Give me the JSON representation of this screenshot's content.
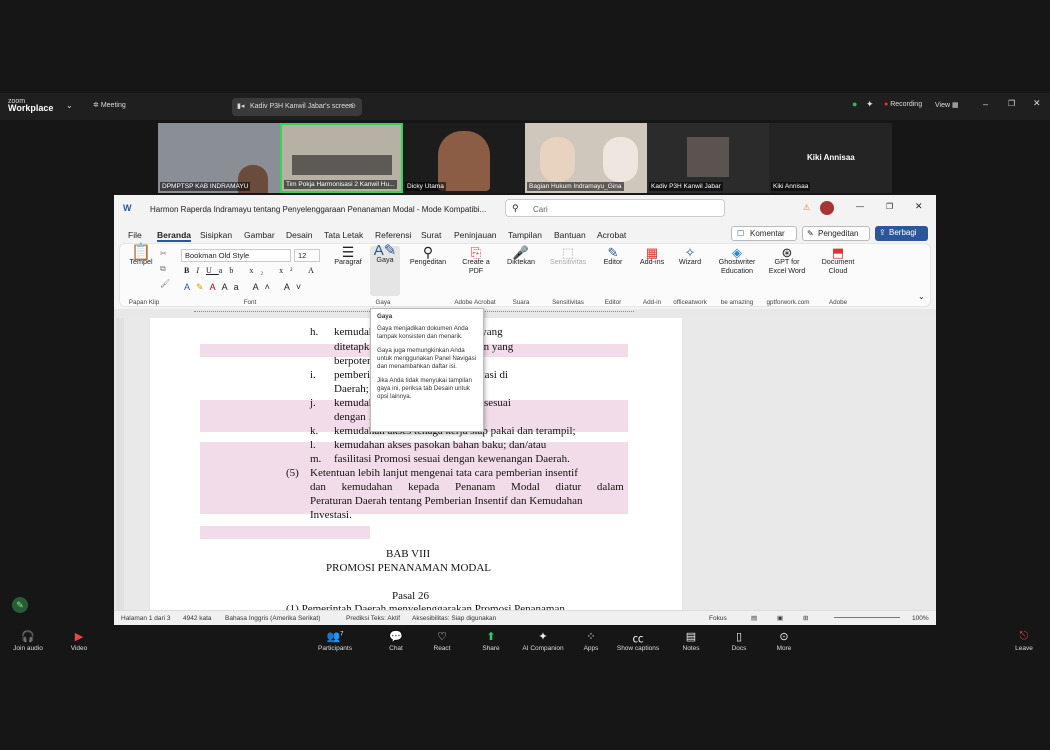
{
  "zoom_bar": {
    "logo_line1": "zoom",
    "logo_line2": "Workplace",
    "meeting": "Meeting",
    "share_title": "Kadiv P3H Kanwil Jabar's screen",
    "recording": "Recording",
    "view": "View"
  },
  "participants": [
    {
      "name": "DPMPTSP KAB INDRAMAYU"
    },
    {
      "name": "Tim Pokja Harmonisasi 2 Kanwil Hu..."
    },
    {
      "name": "Dicky Utama"
    },
    {
      "name": "Bagian Hukum Indramayu_Gina"
    },
    {
      "name": "Kadiv P3H Kanwil Jabar"
    },
    {
      "name": "Kiki Annisaa",
      "display": "Kiki Annisaa"
    }
  ],
  "word": {
    "title": "Harmon Raperda Indramayu tentang Penyelenggaraan Penanaman Modal  -  Mode Kompatibi...",
    "search": "Cari",
    "menu": [
      "File",
      "Beranda",
      "Sisipkan",
      "Gambar",
      "Desain",
      "Tata Letak",
      "Referensi",
      "Surat",
      "Peninjauan",
      "Tampilan",
      "Bantuan",
      "Acrobat"
    ],
    "comment": "Komentar",
    "editing": "Pengeditan",
    "share": "Berbagi",
    "ribbon": {
      "paste": "Tempel",
      "font_name": "Bookman Old Style",
      "font_size": "12",
      "paragraph": "Paragraf",
      "styles": "Gaya",
      "editing": "Pengeditan",
      "create_pdf": "Create a PDF",
      "dictate": "Diktekan",
      "sensitivity": "Sensitivitas",
      "editor": "Editor",
      "addins": "Add-ins",
      "wizard": "Wizard",
      "ghostwriter": "Ghostwriter Education",
      "gpt": "GPT for Excel Word",
      "doc_cloud": "Document Cloud"
    },
    "groups": [
      "Papan Klip",
      "Font",
      "Gaya",
      "Adobe Acrobat",
      "Suara",
      "Sensitivitas",
      "Editor",
      "Add-in",
      "officeatwork",
      "be amazing",
      "gptforwork.com",
      "Adobe"
    ],
    "doc_lines": [
      {
        "n": "h.",
        "t": "kemudahan … kawasan strategis yang"
      },
      {
        "n": "",
        "t": "ditetapkan … perundang-undangan yang"
      },
      {
        "n": "",
        "t": "berpotensi … n Daerah;"
      },
      {
        "n": "i.",
        "t": "pemberian … keamanan berinvestasi di"
      },
      {
        "n": "",
        "t": "Daerah;"
      },
      {
        "n": "j.",
        "t": "kemudahan … si dan standarisasi sesuai"
      },
      {
        "n": "",
        "t": "dengan … perundang-undangan;"
      },
      {
        "n": "k.",
        "t": "kemudahan akses tenaga kerja siap pakai dan terampil;"
      },
      {
        "n": "l.",
        "t": "kemudahan akses pasokan bahan baku; dan/atau"
      },
      {
        "n": "m.",
        "t": "fasilitasi Promosi sesuai dengan kewenangan Daerah."
      }
    ],
    "para5_num": "(5)",
    "para5": [
      "Ketentuan lebih lanjut mengenai tata cara pemberian insentif",
      "dan kemudahan kepada Penanam Modal diatur dalam",
      "Peraturan Daerah tentang Pemberian Insentif dan Kemudahan",
      "Investasi."
    ],
    "bab": "BAB VIII",
    "bab_title": "PROMOSI PENANAMAN MODAL",
    "pasal": "Pasal 26",
    "last_line": "(1)   Pemerintah Daerah menyelenggarakan Promosi Penanaman",
    "tooltip": {
      "title": "Gaya",
      "p1": "Gaya menjadikan dokumen Anda tampak konsisten dan menarik.",
      "p2": "Gaya juga memungkinkan Anda untuk menggunakan Panel Navigasi dan menambahkan daftar isi.",
      "p3": "Jika Anda tidak menyukai tampilan gaya ini, periksa tab Desain untuk opsi lainnya."
    },
    "status": {
      "page": "Halaman 1 dari 3",
      "words": "4942 kata",
      "lang": "Bahasa Inggris (Amerika Serikat)",
      "predict": "Prediksi Teks: Aktif",
      "access": "Aksesibilitas: Siap digunakan",
      "focus": "Fokus",
      "zoom": "100%"
    }
  },
  "bottom": [
    "Join audio",
    "Video",
    "Participants",
    "Chat",
    "React",
    "Share",
    "AI Companion",
    "Apps",
    "Show captions",
    "Notes",
    "Docs",
    "More",
    "Leave"
  ],
  "participant_count": "7"
}
